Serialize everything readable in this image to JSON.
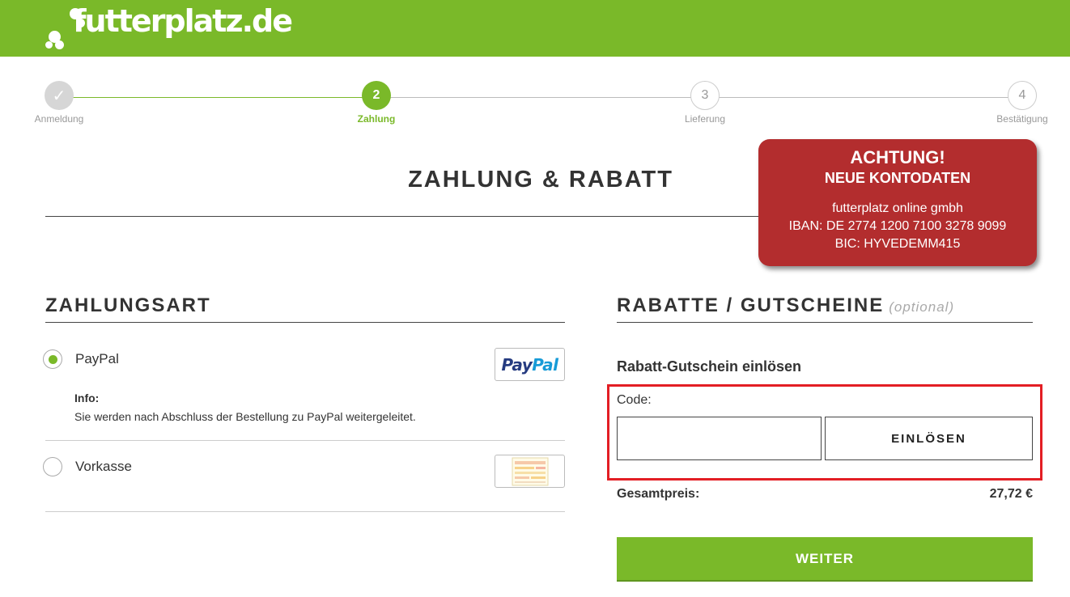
{
  "brand": {
    "logo_text": "futterplatz.de",
    "color": "#7ab929"
  },
  "steps": [
    {
      "label": "Anmeldung",
      "symbol": "✓",
      "state": "done"
    },
    {
      "label": "Zahlung",
      "symbol": "2",
      "state": "active"
    },
    {
      "label": "Lieferung",
      "symbol": "3",
      "state": "todo"
    },
    {
      "label": "Bestätigung",
      "symbol": "4",
      "state": "todo"
    }
  ],
  "page": {
    "title": "ZAHLUNG & RABATT"
  },
  "notice": {
    "headline": "ACHTUNG!",
    "subheadline": "NEUE KONTODATEN",
    "company": "futterplatz online gmbh",
    "iban": "IBAN: DE 2774 1200 7100 3278 9099",
    "bic": "BIC: HYVEDEMM415",
    "color": "#b32d2e"
  },
  "payment": {
    "heading": "ZAHLUNGSART",
    "options": [
      {
        "label": "PayPal",
        "selected": true,
        "logo_icon": "paypal-logo",
        "logo_text_a": "Pay",
        "logo_text_b": "Pal",
        "info_title": "Info:",
        "info_text": "Sie werden nach Abschluss der Bestellung zu PayPal weitergeleitet."
      },
      {
        "label": "Vorkasse",
        "selected": false,
        "logo_icon": "bank-transfer-form-icon"
      }
    ]
  },
  "discounts": {
    "heading": "RABATTE / GUTSCHEINE",
    "optional": "(optional)",
    "redeem_title": "Rabatt-Gutschein einlösen",
    "code_label": "Code:",
    "code_value": "",
    "redeem_button": "EINLÖSEN",
    "total_label": "Gesamtpreis:",
    "total_value": "27,72 €",
    "continue_button": "WEITER"
  }
}
